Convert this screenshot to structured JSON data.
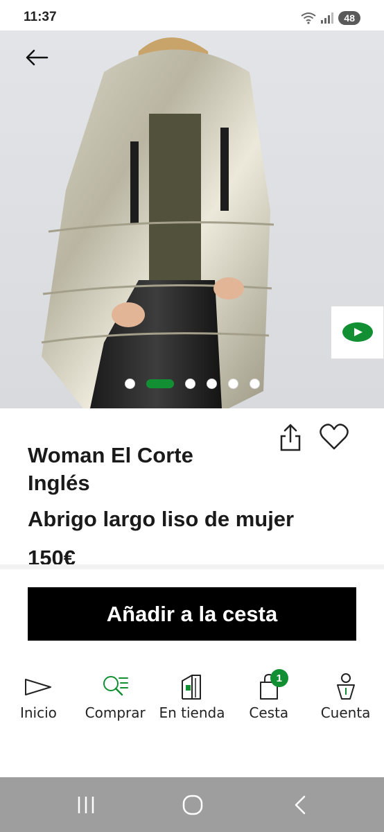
{
  "status_bar": {
    "time": "11:37",
    "battery": "48"
  },
  "carousel": {
    "total_slides": 6,
    "active_index": 1
  },
  "product": {
    "brand": "Woman El Corte Inglés",
    "name": "Abrigo largo liso de mujer",
    "price": "150€"
  },
  "actions": {
    "add_to_cart": "Añadir a la cesta"
  },
  "nav": {
    "items": [
      {
        "label": "Inicio",
        "icon": "home-triangle-icon"
      },
      {
        "label": "Comprar",
        "icon": "search-list-icon"
      },
      {
        "label": "En tienda",
        "icon": "store-building-icon"
      },
      {
        "label": "Cesta",
        "icon": "shopping-bag-icon",
        "badge": "1"
      },
      {
        "label": "Cuenta",
        "icon": "user-icon"
      }
    ]
  },
  "colors": {
    "accent": "#128f33",
    "button_bg": "#000000",
    "system_nav": "#9e9e9e"
  }
}
